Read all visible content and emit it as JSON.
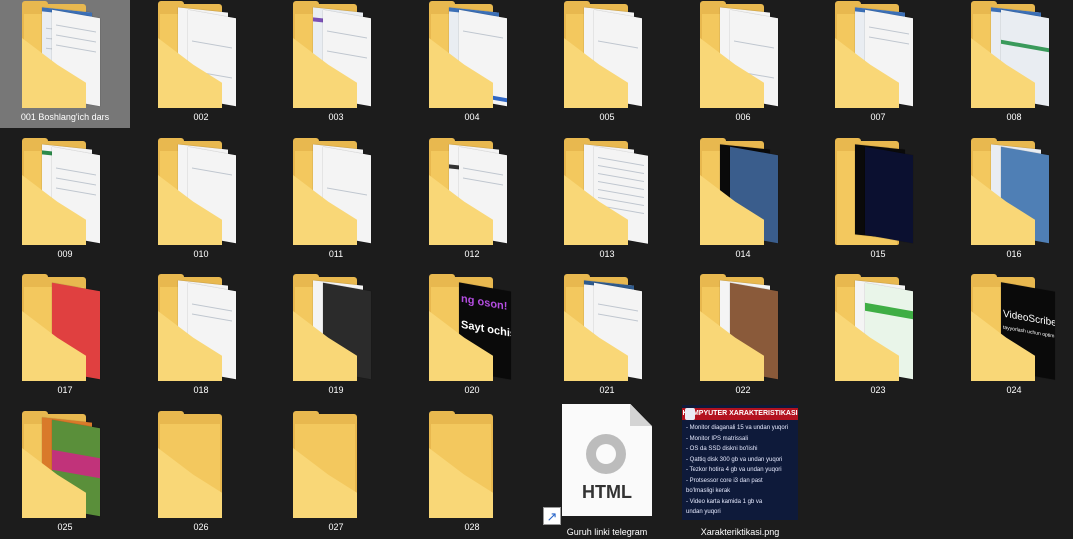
{
  "folders": [
    {
      "label": "001 Boshlang'ich dars",
      "selected": true
    },
    {
      "label": "002"
    },
    {
      "label": "003"
    },
    {
      "label": "004"
    },
    {
      "label": "005"
    },
    {
      "label": "006"
    },
    {
      "label": "007"
    },
    {
      "label": "008"
    },
    {
      "label": "009"
    },
    {
      "label": "010"
    },
    {
      "label": "011"
    },
    {
      "label": "012"
    },
    {
      "label": "013"
    },
    {
      "label": "014"
    },
    {
      "label": "015"
    },
    {
      "label": "016"
    },
    {
      "label": "017"
    },
    {
      "label": "018"
    },
    {
      "label": "019"
    },
    {
      "label": "020"
    },
    {
      "label": "021"
    },
    {
      "label": "022"
    },
    {
      "label": "023"
    },
    {
      "label": "024"
    },
    {
      "label": "025"
    },
    {
      "label": "026"
    },
    {
      "label": "027"
    },
    {
      "label": "028"
    }
  ],
  "thumb_text": {
    "f020_top": "ng oson!",
    "f020_bottom": "Sayt ochis",
    "f024_top": "VideoScribe",
    "f024_bottom": "tayyorlash uchun optim"
  },
  "html_file": {
    "badge": "HTML",
    "label": "Guruh linki telegram"
  },
  "png_file": {
    "label": "Xarakteriktikasi.png",
    "title": "KOMPYUTER XARAKTERISTIKASI",
    "lines": [
      "- Monitor diaganali 15 va undan yuqori",
      "- Monitor IPS matrissali",
      "- OS da SSD diskni bo'lishi",
      "- Qattiq disk 300 gb va undan yuqori",
      "- Tezkor hotira 4 gb va undan yuqori",
      "- Protsessor core i3 dan past",
      "bo'lmasligi kerak",
      "- Video karta kamida 1 gb va",
      "undan yuqori"
    ]
  },
  "colors": {
    "background": "#1c1c1c",
    "selection": "#777777",
    "folder_back": "#e8b84f",
    "folder_front": "#f9d777"
  }
}
